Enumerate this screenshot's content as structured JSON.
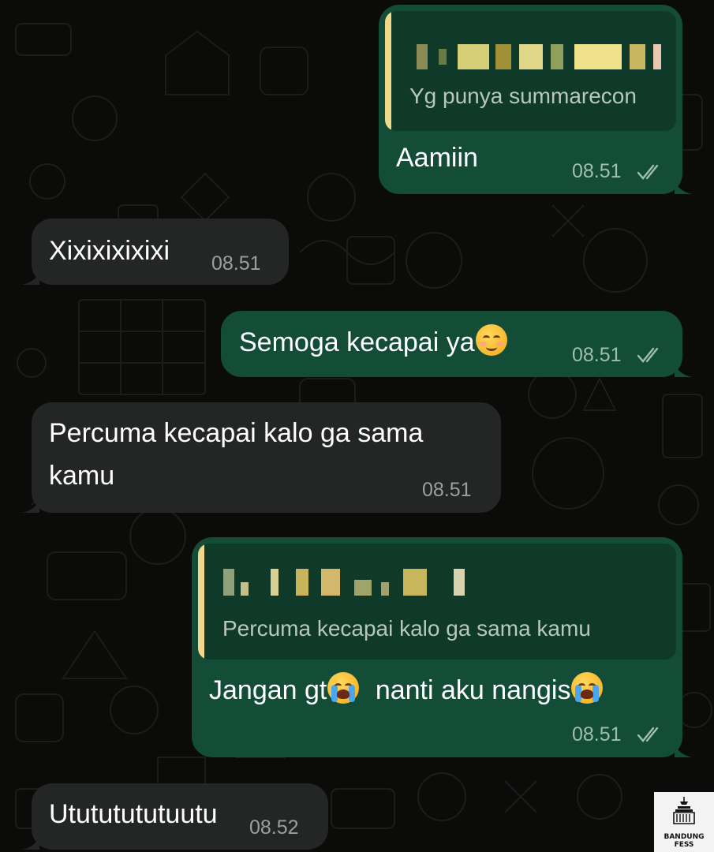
{
  "conversation": {
    "messages": [
      {
        "direction": "outgoing",
        "quote": {
          "author": "",
          "text": "Yg punya summarecon"
        },
        "text": "Aamiin",
        "time": "08.51",
        "status_icon": "double-check-icon"
      },
      {
        "direction": "incoming",
        "text": "Xixixixixixi",
        "time": "08.51"
      },
      {
        "direction": "outgoing",
        "text": "Semoga kecapai ya",
        "emoji": "smiling-face-icon",
        "time": "08.51",
        "status_icon": "double-check-icon"
      },
      {
        "direction": "incoming",
        "text_line1": "Percuma kecapai kalo ga sama",
        "text_line2": "kamu",
        "time": "08.51"
      },
      {
        "direction": "outgoing",
        "quote": {
          "author": "",
          "text": "Percuma kecapai kalo ga sama kamu"
        },
        "text_part1": "Jangan gt",
        "text_part2": "nanti aku nangis",
        "emoji": "loudly-crying-face-icon",
        "time": "08.51",
        "status_icon": "double-check-icon"
      },
      {
        "direction": "incoming",
        "text": "Utututututuutu",
        "time": "08.52"
      }
    ]
  },
  "watermark": {
    "line1": "BANDUNG",
    "line2": "FESS"
  },
  "colors": {
    "background": "#0b0b0a",
    "incoming_bubble": "#242626",
    "outgoing_bubble": "#144d37",
    "quote_bar": "#f0d98a",
    "ticks": "#9fbeb0"
  }
}
